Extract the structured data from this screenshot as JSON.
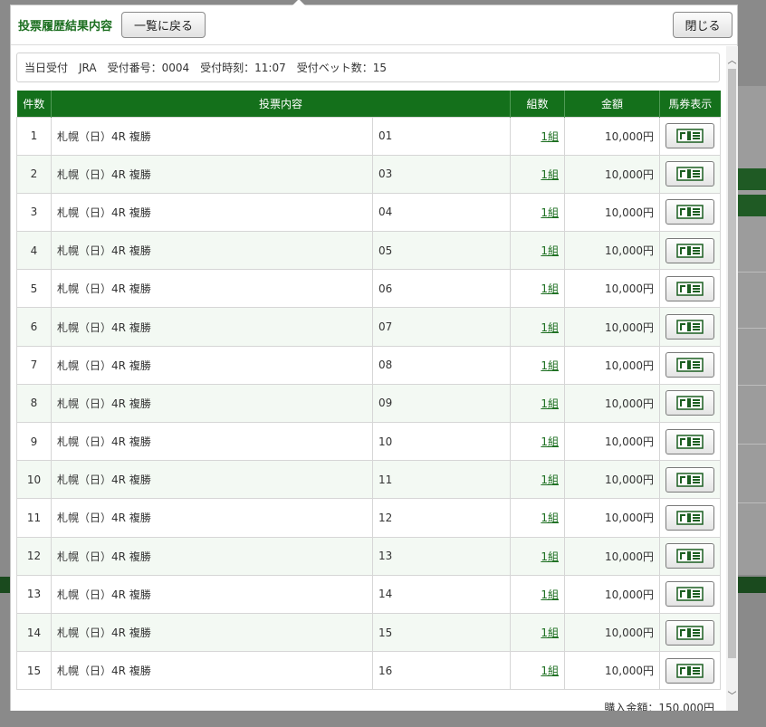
{
  "modal": {
    "title": "投票履歴結果内容",
    "back_label": "一覧に戻る",
    "close_label": "閉じる"
  },
  "info": {
    "text": "当日受付　JRA　受付番号：0004　受付時刻：11:07　受付ベット数：15"
  },
  "table": {
    "headers": [
      "件数",
      "投票内容",
      "組数",
      "金額",
      "馬券表示"
    ],
    "rows": [
      {
        "no": "1",
        "race": "札幌（日）4R 複勝",
        "horse": "01",
        "count": "1組",
        "amount": "10,000円"
      },
      {
        "no": "2",
        "race": "札幌（日）4R 複勝",
        "horse": "03",
        "count": "1組",
        "amount": "10,000円"
      },
      {
        "no": "3",
        "race": "札幌（日）4R 複勝",
        "horse": "04",
        "count": "1組",
        "amount": "10,000円"
      },
      {
        "no": "4",
        "race": "札幌（日）4R 複勝",
        "horse": "05",
        "count": "1組",
        "amount": "10,000円"
      },
      {
        "no": "5",
        "race": "札幌（日）4R 複勝",
        "horse": "06",
        "count": "1組",
        "amount": "10,000円"
      },
      {
        "no": "6",
        "race": "札幌（日）4R 複勝",
        "horse": "07",
        "count": "1組",
        "amount": "10,000円"
      },
      {
        "no": "7",
        "race": "札幌（日）4R 複勝",
        "horse": "08",
        "count": "1組",
        "amount": "10,000円"
      },
      {
        "no": "8",
        "race": "札幌（日）4R 複勝",
        "horse": "09",
        "count": "1組",
        "amount": "10,000円"
      },
      {
        "no": "9",
        "race": "札幌（日）4R 複勝",
        "horse": "10",
        "count": "1組",
        "amount": "10,000円"
      },
      {
        "no": "10",
        "race": "札幌（日）4R 複勝",
        "horse": "11",
        "count": "1組",
        "amount": "10,000円"
      },
      {
        "no": "11",
        "race": "札幌（日）4R 複勝",
        "horse": "12",
        "count": "1組",
        "amount": "10,000円"
      },
      {
        "no": "12",
        "race": "札幌（日）4R 複勝",
        "horse": "13",
        "count": "1組",
        "amount": "10,000円"
      },
      {
        "no": "13",
        "race": "札幌（日）4R 複勝",
        "horse": "14",
        "count": "1組",
        "amount": "10,000円"
      },
      {
        "no": "14",
        "race": "札幌（日）4R 複勝",
        "horse": "15",
        "count": "1組",
        "amount": "10,000円"
      },
      {
        "no": "15",
        "race": "札幌（日）4R 複勝",
        "horse": "16",
        "count": "1組",
        "amount": "10,000円"
      }
    ],
    "ticket_icon": "ticket-icon"
  },
  "total": {
    "text": "購入金額：150,000円"
  },
  "colors": {
    "header_green": "#14701b",
    "title_green": "#1b6e1f"
  }
}
